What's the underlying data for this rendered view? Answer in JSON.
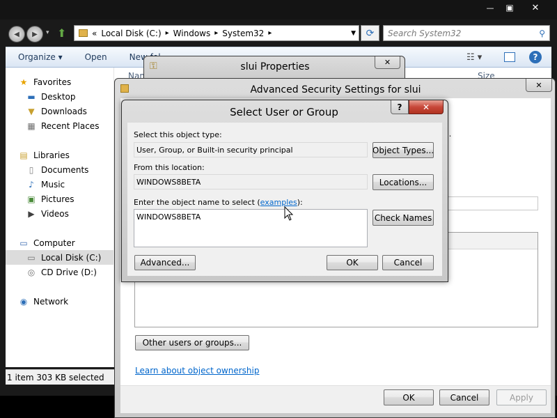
{
  "explorer": {
    "back_glyph": "◀",
    "forward_glyph": "▶",
    "address": {
      "overflow": "«",
      "crumbs": [
        "Local Disk (C:)",
        "Windows",
        "System32"
      ],
      "sep": "▸"
    },
    "refresh_glyph": "⟳",
    "search_placeholder": "Search System32",
    "toolbar": {
      "organize": "Organize ▾",
      "open": "Open",
      "new_folder": "New fol"
    },
    "columns": {
      "name": "Nam",
      "size": "Size"
    },
    "sidebar": [
      {
        "label": "Favorites",
        "icon": "star-icon",
        "glyph": "★",
        "color": "#e8a400"
      },
      {
        "label": "Desktop",
        "icon": "desktop-icon",
        "glyph": "▬",
        "color": "#2d6fb8"
      },
      {
        "label": "Downloads",
        "icon": "downloads-folder-icon",
        "glyph": "▼",
        "color": "#c8a030"
      },
      {
        "label": "Recent Places",
        "icon": "recent-places-icon",
        "glyph": "▦",
        "color": "#707070"
      },
      {
        "label": "Libraries",
        "icon": "libraries-icon",
        "glyph": "▤",
        "color": "#c8a030"
      },
      {
        "label": "Documents",
        "icon": "documents-icon",
        "glyph": "▯",
        "color": "#808080"
      },
      {
        "label": "Music",
        "icon": "music-icon",
        "glyph": "♪",
        "color": "#2d6fb8"
      },
      {
        "label": "Pictures",
        "icon": "pictures-icon",
        "glyph": "▣",
        "color": "#4a8a3a"
      },
      {
        "label": "Videos",
        "icon": "videos-icon",
        "glyph": "▶",
        "color": "#404040"
      },
      {
        "label": "Computer",
        "icon": "computer-icon",
        "glyph": "▭",
        "color": "#3a6ab0"
      },
      {
        "label": "Local Disk (C:)",
        "icon": "drive-icon",
        "glyph": "▭",
        "color": "#707070"
      },
      {
        "label": "CD Drive (D:)",
        "icon": "cd-drive-icon",
        "glyph": "◎",
        "color": "#707070"
      },
      {
        "label": "Network",
        "icon": "network-icon",
        "glyph": "◉",
        "color": "#2d6fb8"
      }
    ],
    "status": "1 item 303 KB selected",
    "selected_item": "Local Disk (C:)"
  },
  "window_buttons": {
    "minimize": "—",
    "maximize": "▣",
    "close": "✕"
  },
  "sl_properties": {
    "title": "slui Properties",
    "close": "✕"
  },
  "advanced": {
    "title": "Advanced Security Settings for slui",
    "close": "✕",
    "truncated_text": "es.",
    "other_users_button": "Other users or groups...",
    "learn_link": "Learn about object ownership",
    "ok": "OK",
    "cancel": "Cancel",
    "apply": "Apply"
  },
  "dialog": {
    "title": "Select User or Group",
    "help": "?",
    "close": "✕",
    "object_type_label": "Select this object type:",
    "object_type_value": "User, Group, or Built-in security principal",
    "object_types_button": "Object Types...",
    "location_label": "From this location:",
    "location_value": "WINDOWS8BETA",
    "locations_button": "Locations...",
    "enter_label_prefix": "Enter the object name to select (",
    "enter_label_link": "examples",
    "enter_label_suffix": "):",
    "object_name_value": "WINDOWS8BETA",
    "check_names_button": "Check Names",
    "advanced_button": "Advanced...",
    "ok": "OK",
    "cancel": "Cancel"
  },
  "colors": {
    "link": "#0066cc",
    "close_red": "#c8483a",
    "selection": "#dcdcdc"
  }
}
